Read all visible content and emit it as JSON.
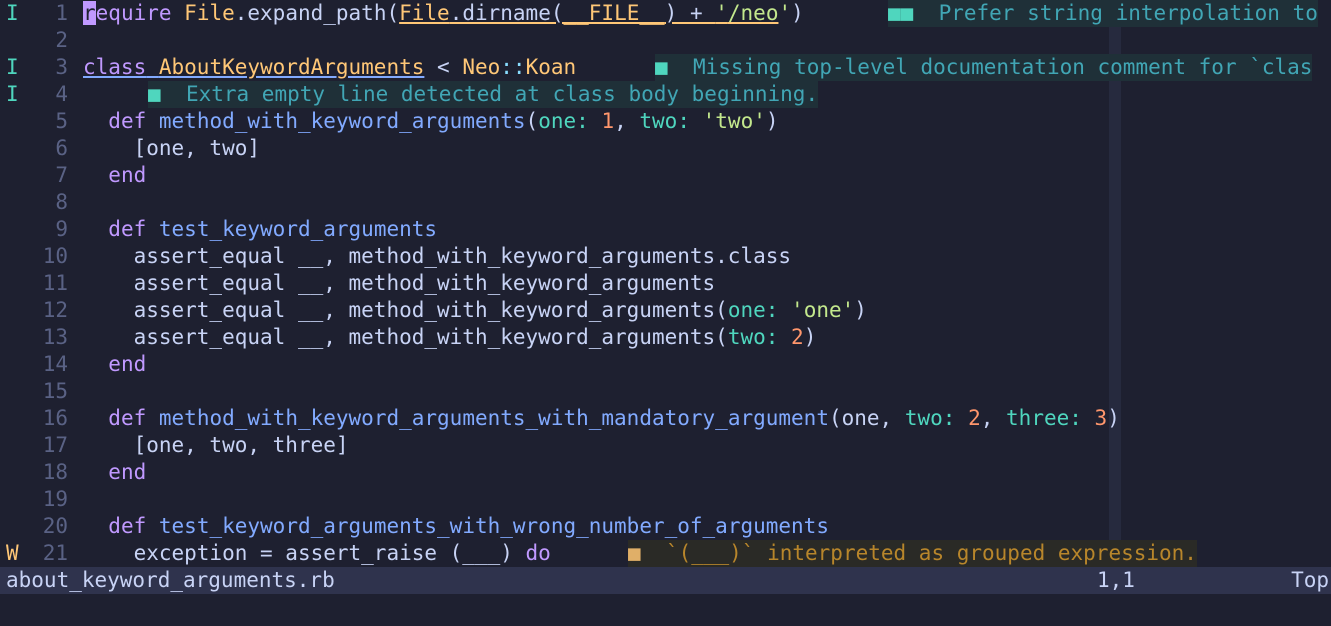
{
  "editor": {
    "lines": [
      {
        "n": "1",
        "sign": "I"
      },
      {
        "n": "2",
        "sign": ""
      },
      {
        "n": "3",
        "sign": "I"
      },
      {
        "n": "4",
        "sign": "I"
      },
      {
        "n": "5",
        "sign": ""
      },
      {
        "n": "6",
        "sign": ""
      },
      {
        "n": "7",
        "sign": ""
      },
      {
        "n": "8",
        "sign": ""
      },
      {
        "n": "9",
        "sign": ""
      },
      {
        "n": "10",
        "sign": ""
      },
      {
        "n": "11",
        "sign": ""
      },
      {
        "n": "12",
        "sign": ""
      },
      {
        "n": "13",
        "sign": ""
      },
      {
        "n": "14",
        "sign": ""
      },
      {
        "n": "15",
        "sign": ""
      },
      {
        "n": "16",
        "sign": ""
      },
      {
        "n": "17",
        "sign": ""
      },
      {
        "n": "18",
        "sign": ""
      },
      {
        "n": "19",
        "sign": ""
      },
      {
        "n": "20",
        "sign": ""
      },
      {
        "n": "21",
        "sign": "W"
      }
    ],
    "code": {
      "l1": {
        "require_r": "r",
        "require_rest": "equire",
        "file1": "File",
        "expand": ".expand_path(",
        "file2": "File",
        "dirname": ".dirname(",
        "file_const": "__FILE__",
        "plus": ") + ",
        "q1": "'",
        "neo": "/neo",
        "q2": "'",
        "close": ")"
      },
      "l3": {
        "class": "class",
        "name": "AboutKeywordArguments",
        "lt": " < ",
        "neo": "Neo",
        "sep": "::",
        "koan": "Koan"
      },
      "l5": {
        "def": "def",
        "name": "method_with_keyword_arguments",
        "open": "(",
        "one": "one:",
        "v1": "1",
        "comma": ", ",
        "two": "two:",
        "q1": "'",
        "v2": "two",
        "q2": "'",
        "close": ")"
      },
      "l6": "[one, two]",
      "l7": "end",
      "l9": {
        "def": "def",
        "name": "test_keyword_arguments"
      },
      "l10": "assert_equal __, method_with_keyword_arguments.class",
      "l11": "assert_equal __, method_with_keyword_arguments",
      "l12": {
        "pre": "assert_equal __, method_with_keyword_arguments(",
        "one": "one:",
        "q1": "'",
        "v": "one",
        "q2": "'",
        "close": ")"
      },
      "l13": {
        "pre": "assert_equal __, method_with_keyword_arguments(",
        "two": "two:",
        "v": "2",
        "close": ")"
      },
      "l14": "end",
      "l16": {
        "def": "def",
        "name": "method_with_keyword_arguments_with_mandatory_argument",
        "open": "(one, ",
        "two": "two:",
        "v2": "2",
        "comma": ", ",
        "three": "three:",
        "v3": "3",
        "close": ")"
      },
      "l17": "[one, two, three]",
      "l18": "end",
      "l20": {
        "def": "def",
        "name": "test_keyword_arguments_with_wrong_number_of_arguments"
      },
      "l21": {
        "pre": "exception = assert_raise (___) ",
        "do": "do"
      }
    },
    "diagnostics": {
      "d1": {
        "marker": "■■",
        "text": "  Prefer string interpolation to"
      },
      "d3": {
        "marker": "■",
        "text": "  Missing top-level documentation comment for `clas"
      },
      "d4": {
        "marker": "■",
        "text": "  Extra empty line detected at class body beginning."
      },
      "d21": {
        "marker": "■",
        "text": "  `(___)` interpreted as grouped expression."
      }
    }
  },
  "statusline": {
    "filename": "about_keyword_arguments.rb",
    "position": "1,1",
    "scroll": "Top"
  },
  "colors": {
    "background": "#1e2030",
    "keyword": "#c099ff",
    "function": "#82aaff",
    "constant": "#ffc777",
    "string": "#c3e88d",
    "number": "#ff966c",
    "info": "#4fd6be",
    "warning": "#e0af68"
  }
}
